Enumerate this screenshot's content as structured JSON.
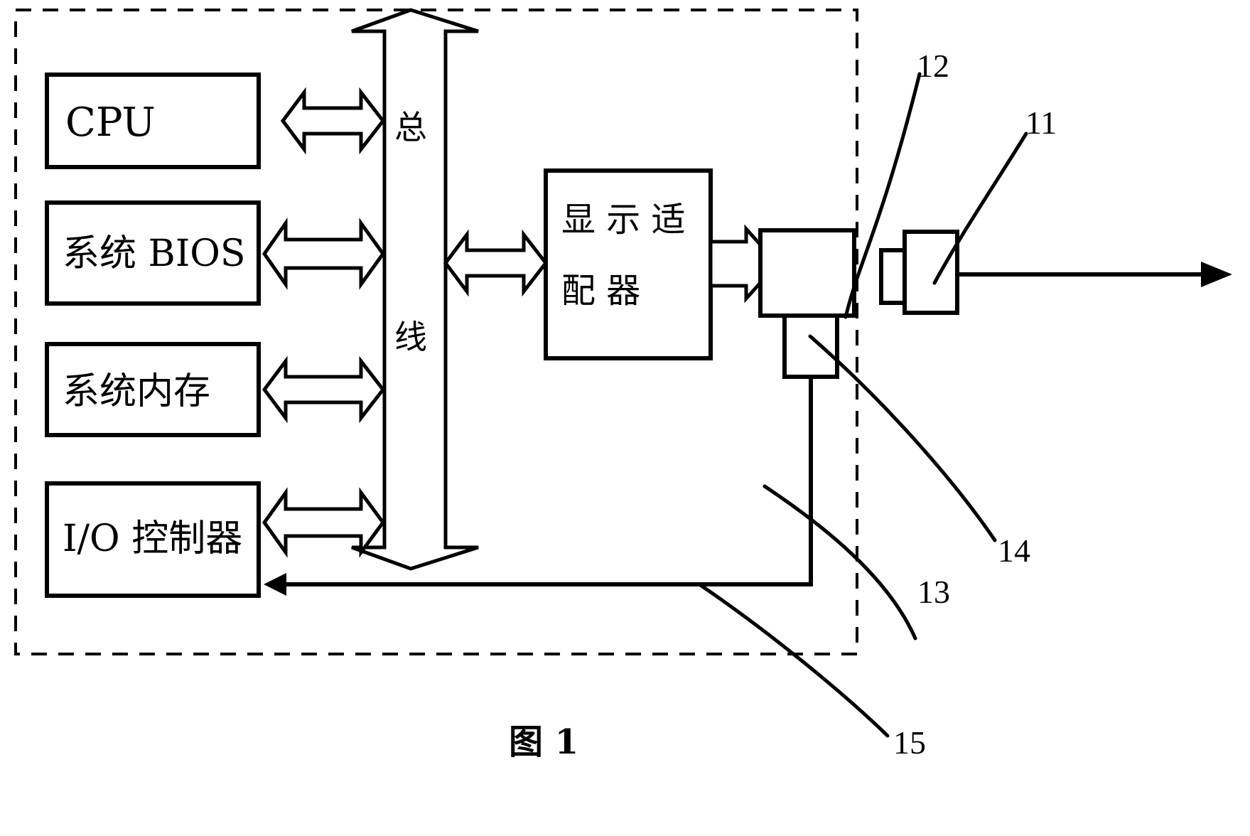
{
  "figure": {
    "caption": "图 1",
    "caption_label": "图",
    "caption_number": "1"
  },
  "blocks": {
    "cpu": {
      "label": "CPU"
    },
    "system_bios": {
      "label": "系统 BIOS"
    },
    "system_memory": {
      "label": "系统内存"
    },
    "io_controller": {
      "label": "I/O 控制器"
    },
    "display_adapter": {
      "label_line1": "显 示 适",
      "label_line2": "配 器",
      "label_full": "显示适配器"
    },
    "bus": {
      "char1": "总",
      "char2": "线",
      "label_full": "总线"
    },
    "unit_12": {
      "label": ""
    },
    "unit_14": {
      "label": ""
    },
    "unit_11": {
      "label": ""
    }
  },
  "reference_numbers": [
    {
      "id": "ref-11",
      "text": "11"
    },
    {
      "id": "ref-12",
      "text": "12"
    },
    {
      "id": "ref-13",
      "text": "13"
    },
    {
      "id": "ref-14",
      "text": "14"
    },
    {
      "id": "ref-15",
      "text": "15"
    }
  ],
  "colors": {
    "line": "#000000",
    "fill": "#ffffff",
    "background": "#ffffff"
  }
}
